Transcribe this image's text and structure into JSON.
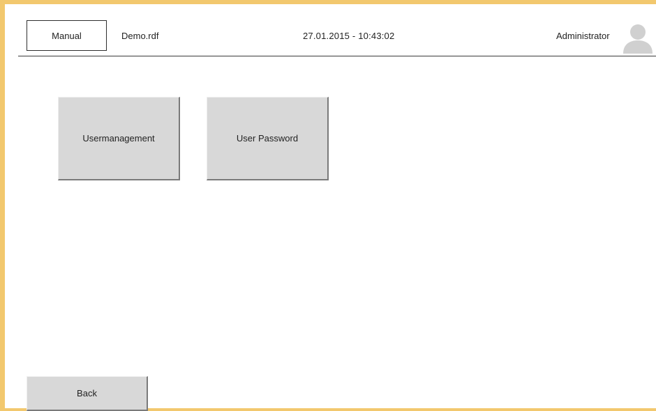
{
  "header": {
    "mode_label": "Manual",
    "file_name": "Demo.rdf",
    "datetime": "27.01.2015  -  10:43:02",
    "user_name": "Administrator",
    "avatar_icon": "user-silhouette-icon"
  },
  "main": {
    "tiles": [
      {
        "label": "Usermanagement"
      },
      {
        "label": "User Password"
      }
    ]
  },
  "footer": {
    "back_label": "Back"
  },
  "colors": {
    "frame_accent": "#f2c86e",
    "button_face": "#d8d8d8",
    "avatar_gray": "#d0d0d0"
  }
}
